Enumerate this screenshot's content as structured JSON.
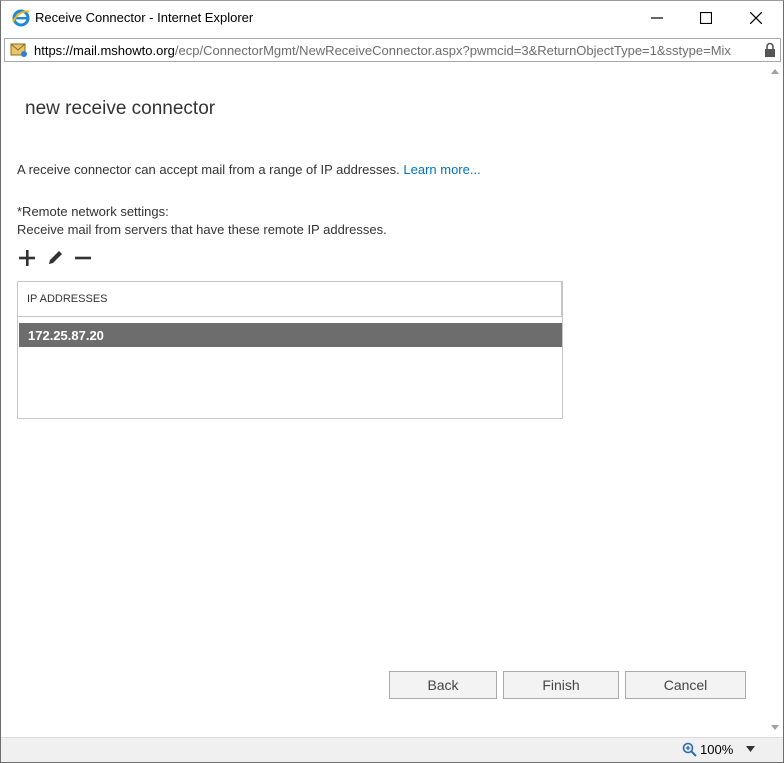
{
  "window": {
    "title": "Receive Connector - Internet Explorer"
  },
  "address_bar": {
    "scheme": "https://",
    "domain": "mail.mshowto.org",
    "path": "/ecp/ConnectorMgmt/NewReceiveConnector.aspx?pwmcid=3&ReturnObjectType=1&sstype=Mix"
  },
  "page": {
    "title": "new receive connector",
    "intro": "A receive connector can accept mail from a range of IP addresses.",
    "learn_more": "Learn more...",
    "section_label": "*Remote network settings:",
    "section_desc": "Receive mail from servers that have these remote IP addresses."
  },
  "ip_table": {
    "header": "IP ADDRESSES",
    "rows": [
      "172.25.87.20"
    ],
    "selected_index": 0
  },
  "buttons": {
    "back": "Back",
    "finish": "Finish",
    "cancel": "Cancel"
  },
  "status_bar": {
    "zoom": "100%"
  },
  "icons": {
    "window": "ie-logo-icon",
    "minimize": "minimize-icon",
    "maximize": "maximize-icon",
    "close": "close-icon",
    "page": "page-icon",
    "lock": "lock-icon",
    "add": "plus-icon",
    "edit": "pencil-icon",
    "remove": "minus-icon",
    "zoom": "zoom-icon"
  },
  "colors": {
    "link": "#0072c6",
    "selected_row": "#6d6d6d"
  }
}
